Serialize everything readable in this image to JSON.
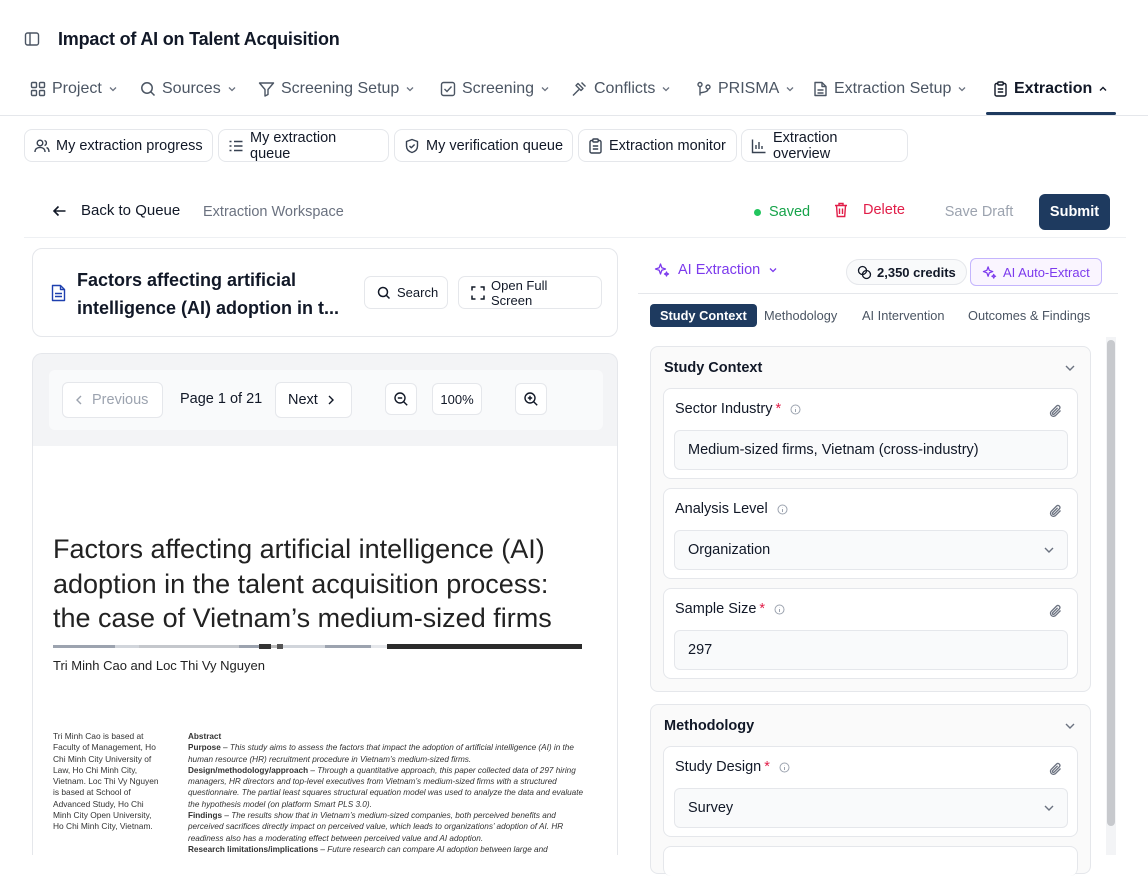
{
  "app": {
    "title": "Impact of AI on Talent Acquisition"
  },
  "topnav": [
    {
      "label": "Project",
      "icon": "grid-icon",
      "open": false
    },
    {
      "label": "Sources",
      "icon": "search-icon",
      "open": false
    },
    {
      "label": "Screening Setup",
      "icon": "filter-icon",
      "open": false
    },
    {
      "label": "Screening",
      "icon": "checkbox-icon",
      "open": false
    },
    {
      "label": "Conflicts",
      "icon": "gavel-icon",
      "open": false
    },
    {
      "label": "PRISMA",
      "icon": "flow-icon",
      "open": false
    },
    {
      "label": "Extraction Setup",
      "icon": "file-icon",
      "open": false
    },
    {
      "label": "Extraction",
      "icon": "clipboard-icon",
      "open": true,
      "active": true
    }
  ],
  "subnav": [
    {
      "label": "My extraction progress",
      "icon": "users-icon"
    },
    {
      "label": "My extraction queue",
      "icon": "list-icon"
    },
    {
      "label": "My verification queue",
      "icon": "shield-check-icon"
    },
    {
      "label": "Extraction monitor",
      "icon": "clipboard-icon"
    },
    {
      "label": "Extraction overview",
      "icon": "bar-chart-icon"
    }
  ],
  "toolbar": {
    "back_label": "Back to Queue",
    "workspace_label": "Extraction Workspace",
    "saved_label": "Saved",
    "delete_label": "Delete",
    "save_draft_label": "Save Draft",
    "submit_label": "Submit",
    "colors": {
      "saved": "#16a34a",
      "delete": "#e11d48",
      "submit_bg": "#1e3a5f"
    }
  },
  "document": {
    "title": "Factors affecting artificial intelligence (AI) adoption in t...",
    "search_label": "Search",
    "fullscreen_label": "Open Full Screen"
  },
  "viewer": {
    "prev_label": "Previous",
    "page_label": "Page 1 of 21",
    "next_label": "Next",
    "zoom": "100%"
  },
  "paper": {
    "title": "Factors affecting artificial intelligence (AI) adoption in the talent acquisition process: the case of Vietnam’s medium-sized firms",
    "authors": "Tri Minh Cao and Loc Thi Vy Nguyen",
    "affiliation": "Tri Minh Cao is based at Faculty of Management, Ho Chi Minh City University of Law, Ho Chi Minh City, Vietnam. Loc Thi Vy Nguyen is based at School of Advanced Study, Ho Chi Minh City Open University, Ho Chi Minh City, Vietnam.",
    "abstract_heading": "Abstract",
    "purpose_label": "Purpose",
    "purpose_text": " – This study aims to assess the factors that impact the adoption of artificial intelligence (AI) in the human resource (HR) recruitment procedure in Vietnam’s medium-sized firms.",
    "design_label": "Design/methodology/approach",
    "design_text": " – Through a quantitative approach, this paper collected data of 297 hiring managers, HR directors and top-level executives from Vietnam’s medium-sized firms with a structured questionnaire. The partial least squares structural equation model was used to analyze the data and evaluate the hypothesis model (on platform Smart PLS 3.0).",
    "findings_label": "Findings",
    "findings_text": " – The results show that in Vietnam’s medium-sized companies, both perceived benefits and perceived sacrifices directly impact on perceived value, which leads to organizations’ adoption of AI. HR readiness also has a moderating effect between perceived value and AI adoption.",
    "research_label": "Research limitations/implications",
    "research_text": " – Future research can compare AI adoption between large and"
  },
  "ai_panel": {
    "label": "AI Extraction",
    "credits": "2,350 credits",
    "auto_extract_label": "AI Auto-Extract",
    "accent": "#7c3aed"
  },
  "tabs": [
    {
      "label": "Study Context",
      "active": true
    },
    {
      "label": "Methodology",
      "active": false
    },
    {
      "label": "AI Intervention",
      "active": false
    },
    {
      "label": "Outcomes & Findings",
      "active": false
    }
  ],
  "sections": {
    "study_context": {
      "title": "Study Context",
      "fields": [
        {
          "label": "Sector Industry",
          "required": true,
          "value": "Medium-sized firms, Vietnam (cross-industry)",
          "type": "text"
        },
        {
          "label": "Analysis Level",
          "required": false,
          "value": "Organization",
          "type": "select"
        },
        {
          "label": "Sample Size",
          "required": true,
          "value": "297",
          "type": "text"
        }
      ]
    },
    "methodology": {
      "title": "Methodology",
      "fields": [
        {
          "label": "Study Design",
          "required": true,
          "value": "Survey",
          "type": "select"
        }
      ]
    }
  },
  "required_marker": "*"
}
